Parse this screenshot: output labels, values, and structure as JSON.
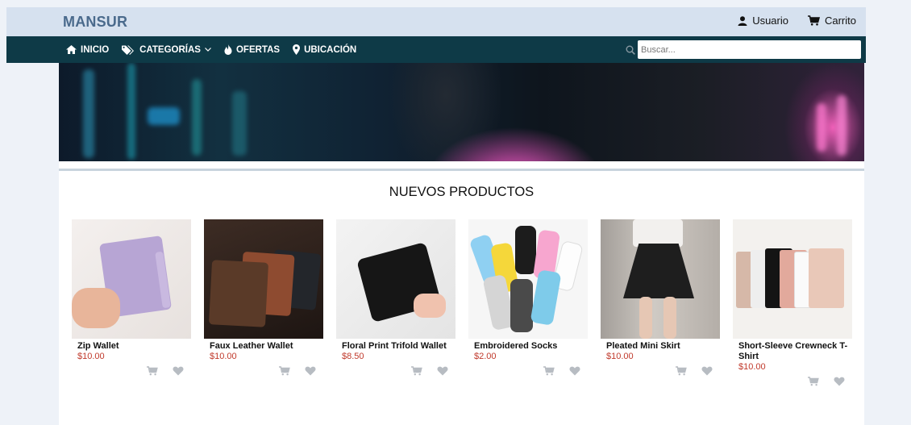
{
  "brand": {
    "logo": "MANSUR"
  },
  "top": {
    "user_label": "Usuario",
    "cart_label": "Carrito"
  },
  "nav": {
    "items": [
      {
        "label": "INICIO",
        "icon": "home-icon"
      },
      {
        "label": "CATEGORÍAS",
        "icon": "tags-icon"
      },
      {
        "label": "OFERTAS",
        "icon": "fire-icon"
      },
      {
        "label": "UBICACIÓN",
        "icon": "map-marker-icon"
      }
    ],
    "search_placeholder": "Buscar..."
  },
  "section": {
    "title": "NUEVOS PRODUCTOS"
  },
  "products": [
    {
      "name": "Zip Wallet",
      "price": "$10.00"
    },
    {
      "name": "Faux Leather Wallet",
      "price": "$10.00"
    },
    {
      "name": "Floral Print Trifold Wallet",
      "price": "$8.50"
    },
    {
      "name": "Embroidered Socks",
      "price": "$2.00"
    },
    {
      "name": "Pleated Mini Skirt",
      "price": "$10.00"
    },
    {
      "name": "Short-Sleeve Crewneck T-Shirt",
      "price": "$10.00"
    }
  ],
  "colors": {
    "topbar": "#d6e1ef",
    "navbar": "#0e3a47",
    "price": "#c0392b",
    "action_icons": "#b7bcc2"
  }
}
